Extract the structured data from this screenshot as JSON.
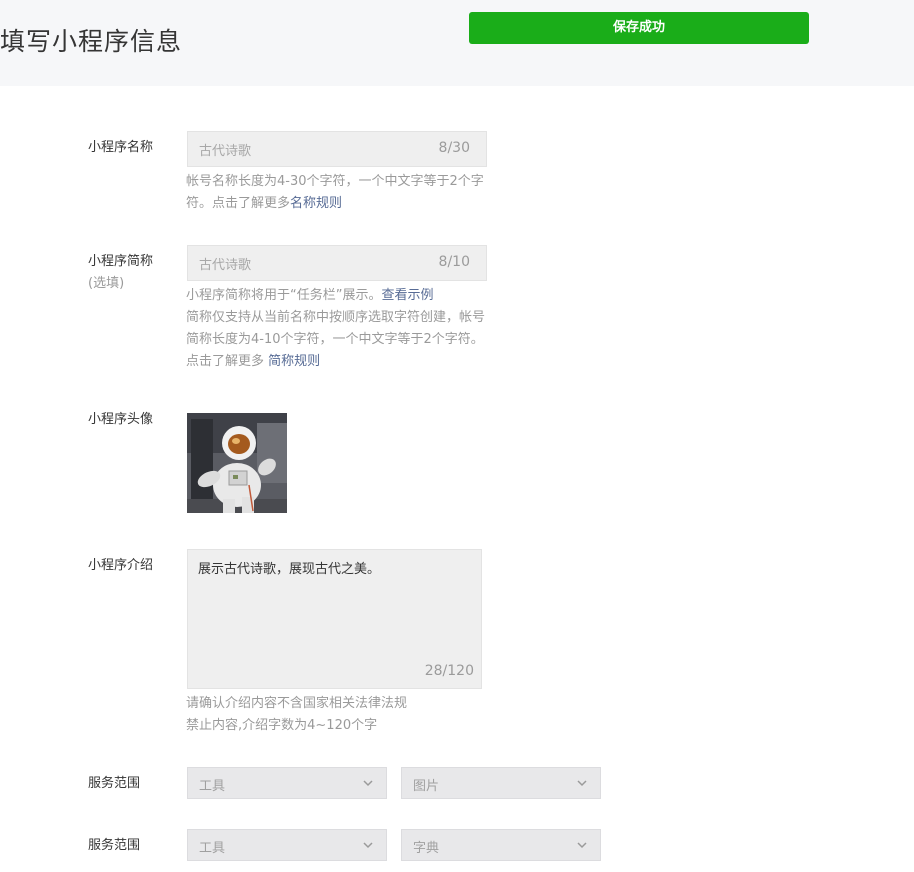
{
  "header": {
    "title": "填写小程序信息",
    "toast": "保存成功"
  },
  "name_field": {
    "label": "小程序名称",
    "value": "古代诗歌",
    "count": "8/30",
    "hint": "帐号名称长度为4-30个字符，一个中文字等于2个字符。点击了解更多",
    "hint_link": "名称规则"
  },
  "short_name_field": {
    "label": "小程序简称",
    "label_sub": "(选填)",
    "value": "古代诗歌",
    "count": "8/10",
    "hint_line1": "小程序简称将用于“任务栏”展示。",
    "hint_link1": "查看示例",
    "hint_line2": "简称仅支持从当前名称中按顺序选取字符创建，帐号简称长度为4-10个字符，一个中文字等于2个字符。点击了解更多 ",
    "hint_link2": "简称规则"
  },
  "avatar": {
    "label": "小程序头像"
  },
  "intro_field": {
    "label": "小程序介绍",
    "value": "展示古代诗歌，展现古代之美。",
    "count": "28/120",
    "hint_line1": "请确认介绍内容不含国家相关法律法规",
    "hint_line2": "禁止内容,介绍字数为4~120个字"
  },
  "service_rows": [
    {
      "label": "服务范围",
      "first": "工具",
      "second": "图片"
    },
    {
      "label": "服务范围",
      "first": "工具",
      "second": "字典"
    }
  ],
  "colors": {
    "accent": "#1aad19",
    "link": "#576b95",
    "header_bg": "#f6f7f9"
  }
}
